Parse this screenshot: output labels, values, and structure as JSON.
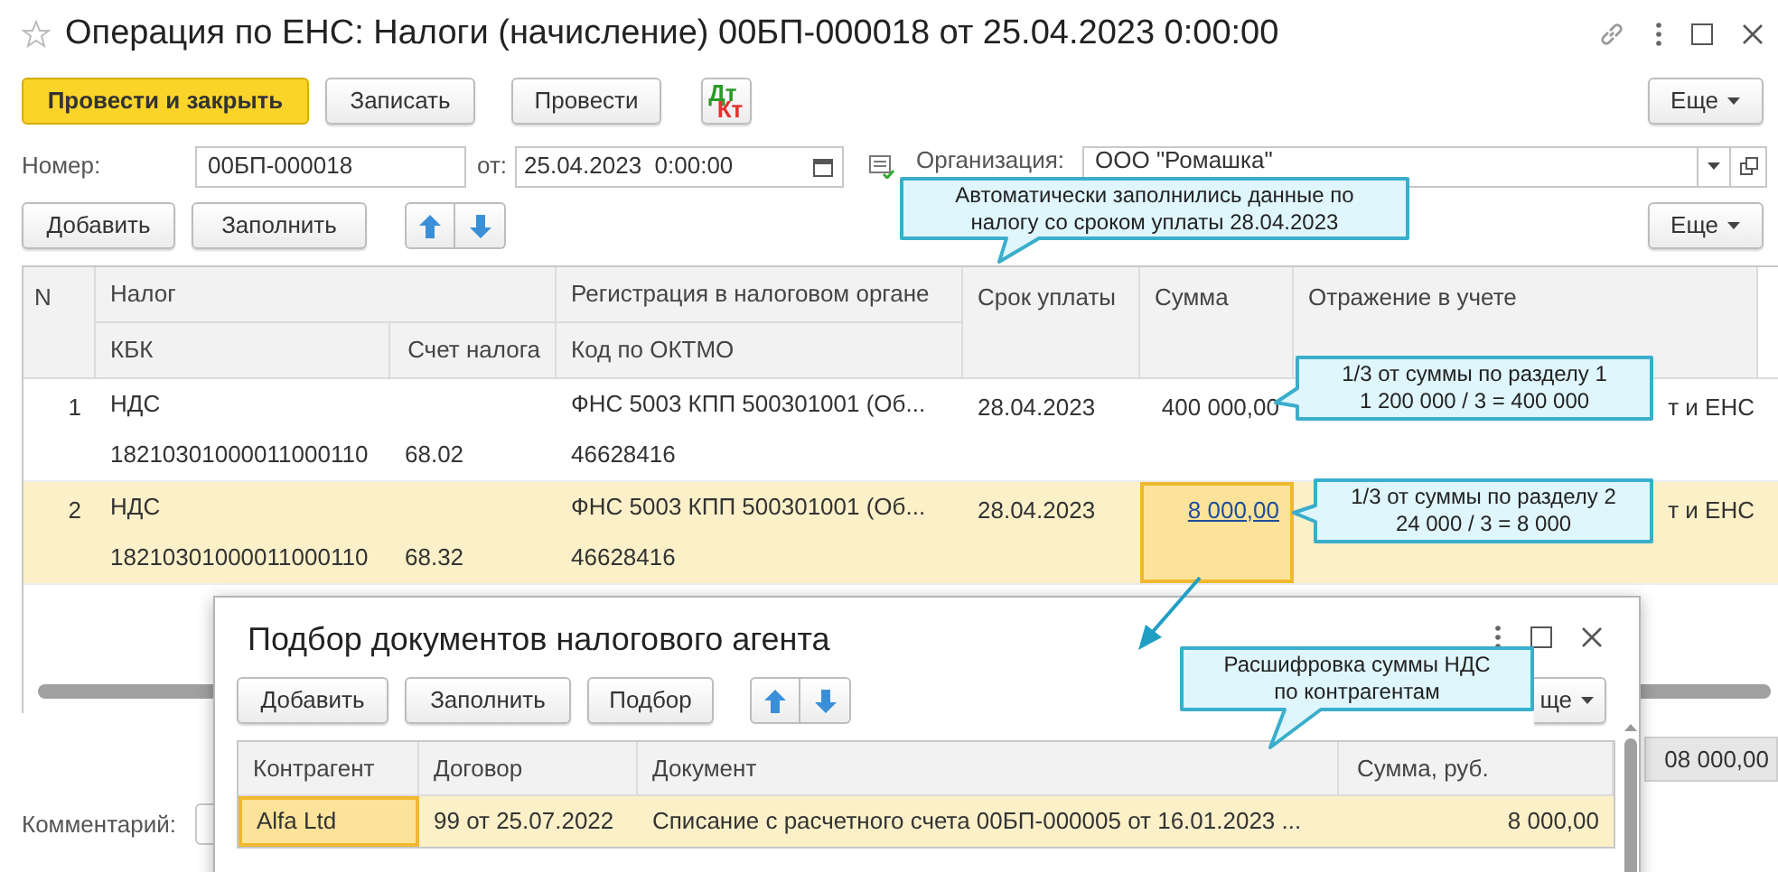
{
  "window": {
    "title": "Операция по ЕНС: Налоги (начисление) 00БП-000018 от 25.04.2023 0:00:00"
  },
  "toolbar": {
    "buttons": [
      {
        "kind": "primary",
        "label": "Провести и закрыть"
      },
      {
        "kind": "default",
        "label": "Записать"
      },
      {
        "kind": "default",
        "label": "Провести"
      },
      {
        "kind": "dtkt",
        "debit": "Дт",
        "credit": "Кт"
      }
    ],
    "more": "Еще"
  },
  "header": {
    "number_label": "Номер:",
    "number": "00БП-000018",
    "date_label": "от:",
    "date": "25.04.2023  0:00:00",
    "org_label": "Организация:",
    "org": "ООО \"Ромашка\""
  },
  "table_toolbar": {
    "buttons": [
      "Добавить",
      "Заполнить"
    ],
    "more": "Еще"
  },
  "table": {
    "columns": {
      "n": "N",
      "tax": "Налог",
      "kbk": "КБК",
      "account": "Счет налога",
      "registration": "Регистрация в налоговом органе",
      "oktmo": "Код по ОКТМО",
      "due": "Срок уплаты",
      "amount": "Сумма",
      "accounting": "Отражение в учете"
    },
    "rows": [
      {
        "n": "1",
        "tax": "НДС",
        "kbk": "18210301000011000110",
        "account": "68.02",
        "registration": "ФНС 5003 КПП 500301001 (Об...",
        "oktmo": "46628416",
        "due": "28.04.2023",
        "amount": "400 000,00",
        "accounting": "т и ЕНС",
        "selected": false
      },
      {
        "n": "2",
        "tax": "НДС",
        "kbk": "18210301000011000110",
        "account": "68.32",
        "registration": "ФНС 5003 КПП 500301001 (Об...",
        "oktmo": "46628416",
        "due": "28.04.2023",
        "amount": "8 000,00",
        "accounting": "т и ЕНС",
        "selected": true
      }
    ]
  },
  "total": "08 000,00",
  "comment_label": "Комментарий:",
  "dialog": {
    "title": "Подбор документов налогового агента",
    "buttons": [
      "Добавить",
      "Заполнить",
      "Подбор"
    ],
    "more": "ще",
    "columns": {
      "counterparty": "Контрагент",
      "contract": "Договор",
      "document": "Документ",
      "amount": "Сумма, руб."
    },
    "rows": [
      {
        "counterparty": "Alfa Ltd",
        "contract": "99 от 25.07.2022",
        "document": "Списание с расчетного счета 00БП-000005 от 16.01.2023 ...",
        "amount": "8 000,00",
        "selected": true
      }
    ]
  },
  "callouts": [
    {
      "lines": [
        "Автоматически заполнились данные по",
        "налогу со сроком уплаты 28.04.2023"
      ]
    },
    {
      "lines": [
        "1/3 от суммы по разделу  1",
        "1 200 000 / 3 = 400 000"
      ]
    },
    {
      "lines": [
        "1/3 от суммы по разделу 2",
        "24 000 / 3 = 8 000"
      ]
    },
    {
      "lines": [
        "Расшифровка суммы НДС",
        "по контрагентам"
      ]
    }
  ]
}
